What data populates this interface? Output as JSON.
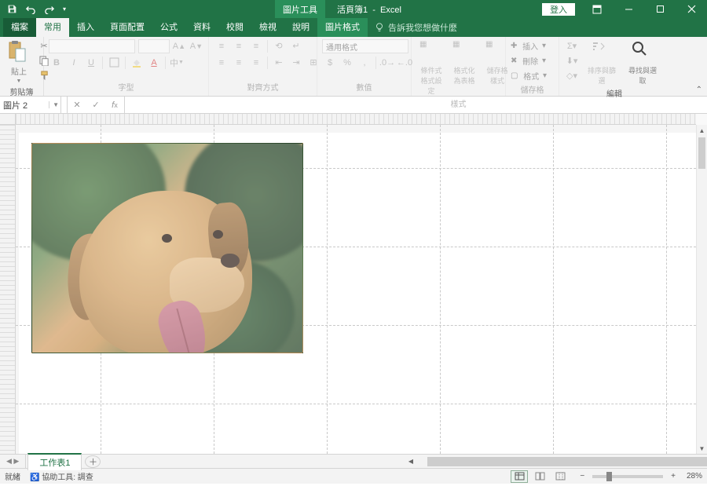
{
  "title": {
    "contextual_label": "圖片工具",
    "doc": "活頁簿1",
    "app": "Excel",
    "login": "登入"
  },
  "tabs": {
    "file": "檔案",
    "home": "常用",
    "insert": "插入",
    "layout": "頁面配置",
    "formulas": "公式",
    "data": "資料",
    "review": "校閱",
    "view": "檢視",
    "help": "說明",
    "picture_format": "圖片格式",
    "tell_me": "告訴我您想做什麼"
  },
  "ribbon": {
    "clipboard": {
      "paste": "貼上",
      "label": "剪貼簿"
    },
    "font": {
      "label": "字型",
      "bold": "B",
      "italic": "I",
      "underline": "U"
    },
    "alignment": {
      "label": "對齊方式"
    },
    "number": {
      "label": "數值",
      "format": "通用格式"
    },
    "styles": {
      "label": "樣式",
      "conditional": "條件式格式設定",
      "as_table": "格式化為表格",
      "cell_styles": "儲存格樣式"
    },
    "cells": {
      "label": "儲存格",
      "insert": "插入",
      "delete": "刪除",
      "format": "格式"
    },
    "editing": {
      "label": "編輯",
      "sort_filter": "排序與篩選",
      "find_select": "尋找與選取"
    }
  },
  "name_box": "圖片 2",
  "sheet_tab": "工作表1",
  "status": {
    "ready": "就緒",
    "a11y": "協助工具: 調查",
    "zoom": "28%"
  },
  "picture": {
    "alt": "golden-retriever-dog-outdoors"
  }
}
